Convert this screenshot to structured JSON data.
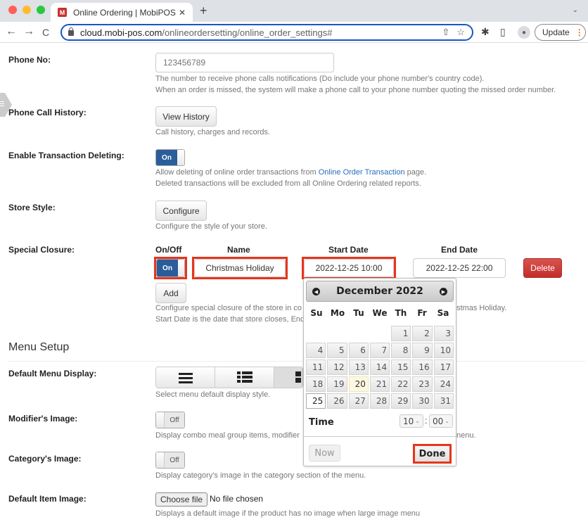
{
  "browser": {
    "tab_title": "Online Ordering | MobiPOS",
    "favicon_text": "M",
    "url_host": "cloud.mobi-pos.com",
    "url_path": "/onlineordersetting/online_order_settings#",
    "update_label": "Update",
    "icons": {
      "back": "←",
      "forward": "→",
      "reload": "C",
      "share": "⇧",
      "star": "☆",
      "extensions": "✱",
      "sidepanel": "▯",
      "profile": "●",
      "close": "✕",
      "newtab": "+",
      "tabmenu": "⌄",
      "kebab": "⋮"
    }
  },
  "settings": {
    "phone_no": {
      "label": "Phone No:",
      "placeholder": "123456789",
      "help1": "The number to receive phone calls notifications (Do include your phone number's country code).",
      "help2": "When an order is missed, the system will make a phone call to your phone number quoting the missed order number."
    },
    "phone_history": {
      "label": "Phone Call History:",
      "button": "View History",
      "help": "Call history, charges and records."
    },
    "transaction_deleting": {
      "label": "Enable Transaction Deleting:",
      "toggle": "On",
      "state": "on",
      "help1_pre": "Allow deleting of online order transactions from ",
      "help1_link": "Online Order Transaction",
      "help1_post": " page.",
      "help2": "Deleted transactions will be excluded from all Online Ordering related reports."
    },
    "store_style": {
      "label": "Store Style:",
      "button": "Configure",
      "help": "Configure the style of your store."
    },
    "special_closure": {
      "label": "Special Closure:",
      "columns": [
        "On/Off",
        "Name",
        "Start Date",
        "End Date"
      ],
      "row": {
        "toggle": "On",
        "state": "on",
        "name": "Christmas Holiday",
        "start_date": "2022-12-25 10:00",
        "end_date": "2022-12-25 22:00",
        "delete": "Delete"
      },
      "add": "Add",
      "help1_left": "Configure special closure of the store in co",
      "help1_right": "stmas Holiday.",
      "help2_left": "Start Date is the date that store closes, End"
    }
  },
  "menu_setup": {
    "title": "Menu Setup",
    "default_display": {
      "label": "Default Menu Display:",
      "options": [
        "list-icon",
        "detailed-list-icon",
        "grid-icon"
      ],
      "selected": 2,
      "help": "Select menu default display style."
    },
    "modifier_image": {
      "label": "Modifier's Image:",
      "toggle": "Off",
      "state": "off",
      "help_left": "Display combo meal group items, modifier ",
      "help_right": "nenu."
    },
    "category_image": {
      "label": "Category's Image:",
      "toggle": "Off",
      "state": "off",
      "help": "Display category's image in the category section of the menu."
    },
    "default_item_image": {
      "label": "Default Item Image:",
      "button": "Choose file",
      "file_status": "No file chosen",
      "help": "Displays a default image if the product has no image when large image menu"
    }
  },
  "datepicker": {
    "month_year": "December 2022",
    "weekdays": [
      "Su",
      "Mo",
      "Tu",
      "We",
      "Th",
      "Fr",
      "Sa"
    ],
    "leading_blanks": 4,
    "days": 31,
    "today": 20,
    "selected": 25,
    "time_label": "Time",
    "hour": "10",
    "minute": "00",
    "now": "Now",
    "done": "Done"
  },
  "colors": {
    "accent_blue": "#2a5d9a",
    "delete_red": "#c9302c",
    "highlight_red": "#e8341c",
    "link_blue": "#2a6ebb"
  }
}
